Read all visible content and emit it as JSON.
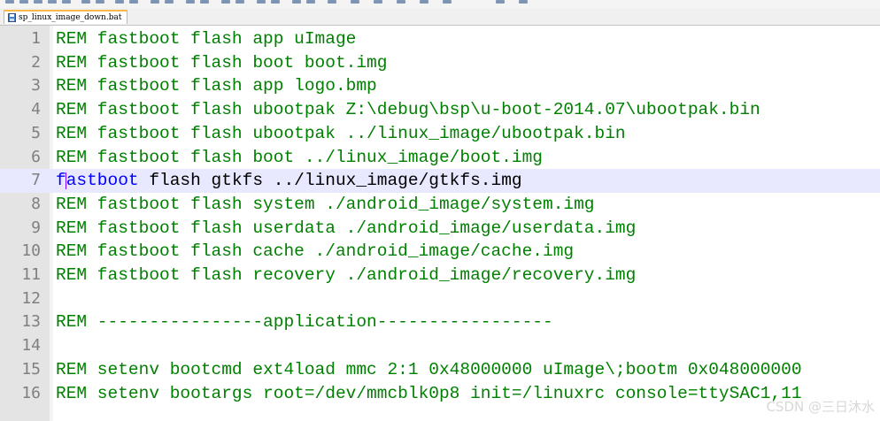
{
  "tab": {
    "file_name": "sp_linux_image_down.bat",
    "icon": "save-disk-icon",
    "accent_color": "#f6b94a"
  },
  "editor": {
    "comment_color": "#008000",
    "keyword_color": "#0000ff",
    "current_line_color": "#e8e8ff",
    "current_line": 7,
    "lines": [
      {
        "number": "1",
        "text": "REM fastboot flash app uImage"
      },
      {
        "number": "2",
        "text": "REM fastboot flash boot boot.img"
      },
      {
        "number": "3",
        "text": "REM fastboot flash app logo.bmp"
      },
      {
        "number": "4",
        "text": "REM fastboot flash ubootpak Z:\\debug\\bsp\\u-boot-2014.07\\ubootpak.bin"
      },
      {
        "number": "5",
        "text": "REM fastboot flash ubootpak ../linux_image/ubootpak.bin"
      },
      {
        "number": "6",
        "text": "REM fastboot flash boot ../linux_image/boot.img"
      },
      {
        "number": "7",
        "keyword": "fastboot",
        "rest": " flash gtkfs ../linux_image/gtkfs.img"
      },
      {
        "number": "8",
        "text": "REM fastboot flash system ./android_image/system.img"
      },
      {
        "number": "9",
        "text": "REM fastboot flash userdata ./android_image/userdata.img"
      },
      {
        "number": "10",
        "text": "REM fastboot flash cache ./android_image/cache.img"
      },
      {
        "number": "11",
        "text": "REM fastboot flash recovery ./android_image/recovery.img"
      },
      {
        "number": "12",
        "text": ""
      },
      {
        "number": "13",
        "text": "REM ----------------application-----------------"
      },
      {
        "number": "14",
        "text": ""
      },
      {
        "number": "15",
        "text": "REM setenv bootcmd ext4load mmc 2:1 0x48000000 uImage\\;bootm 0x048000000"
      },
      {
        "number": "16",
        "text": "REM setenv bootargs root=/dev/mmcblk0p8 init=/linuxrc console=ttySAC1,11"
      }
    ]
  },
  "watermark": "CSDN @三日沐水"
}
